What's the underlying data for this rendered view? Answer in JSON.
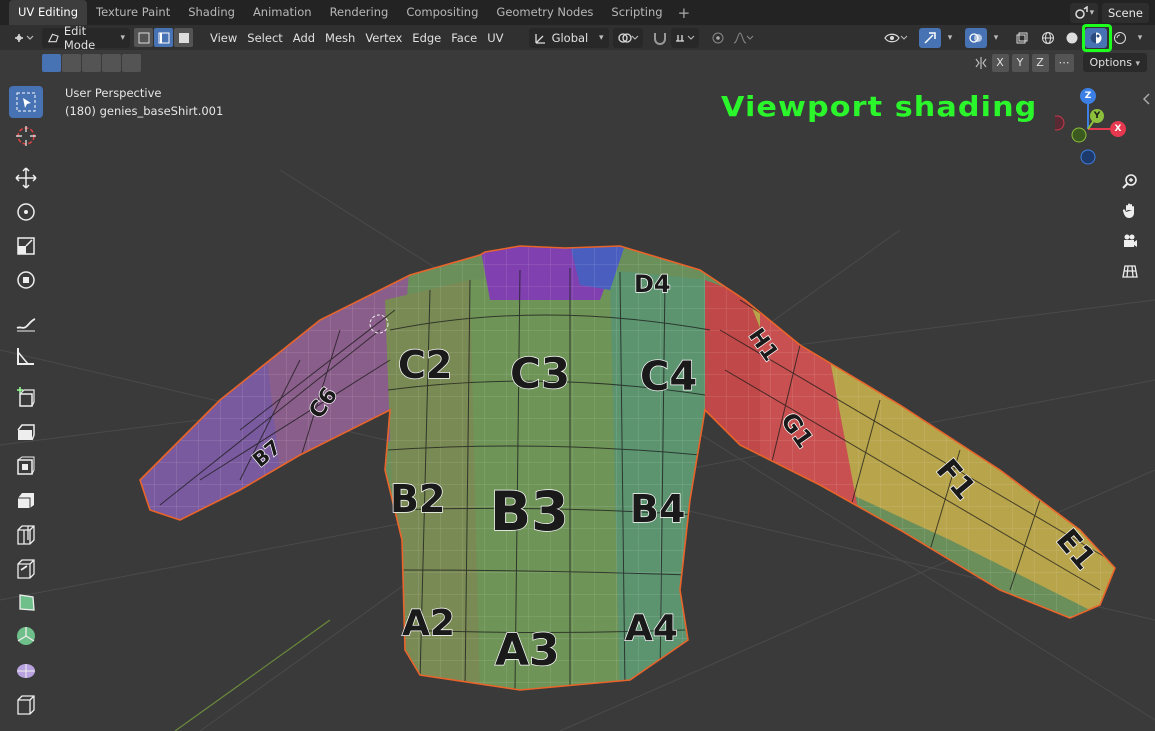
{
  "workspace_tabs": [
    "UV Editing",
    "Texture Paint",
    "Shading",
    "Animation",
    "Rendering",
    "Compositing",
    "Geometry Nodes",
    "Scripting"
  ],
  "active_tab_index": 0,
  "scene": {
    "name": "Scene"
  },
  "header": {
    "mode": "Edit Mode",
    "menus": [
      "View",
      "Select",
      "Add",
      "Mesh",
      "Vertex",
      "Edge",
      "Face",
      "UV"
    ],
    "orientation": "Global"
  },
  "subheader": {
    "axes": [
      "X",
      "Y",
      "Z"
    ],
    "options_label": "Options"
  },
  "viewport": {
    "perspective": "User Perspective",
    "object": "(180) genies_baseShirt.001"
  },
  "annotation": "Viewport shading",
  "gizmo": {
    "z": "Z",
    "y": "Y",
    "x": "X"
  },
  "uv_labels": [
    "D4",
    "C2",
    "C3",
    "C4",
    "B2",
    "B3",
    "B4",
    "A2",
    "A3",
    "A4",
    "H1",
    "G1",
    "F1",
    "E1",
    "C6",
    "B7"
  ],
  "colors": {
    "accent": "#4772b3",
    "highlight": "#1dff1d",
    "annotation": "#2bf52b",
    "x_axis": "#e6394f",
    "y_axis": "#8bbf3c",
    "z_axis": "#3c80e6"
  },
  "icons": [
    "select-box-icon",
    "cursor-icon",
    "move-icon",
    "rotate-icon",
    "scale-icon",
    "transform-icon",
    "annotate-icon",
    "measure-icon",
    "add-cube-icon",
    "extrude-icon",
    "inset-icon",
    "bevel-icon",
    "loop-cut-icon",
    "knife-icon",
    "poly-build-icon",
    "spin-icon",
    "smooth-icon",
    "shrink-icon",
    "zoom-icon",
    "pan-hand-icon",
    "camera-icon",
    "grid-ortho-icon"
  ]
}
